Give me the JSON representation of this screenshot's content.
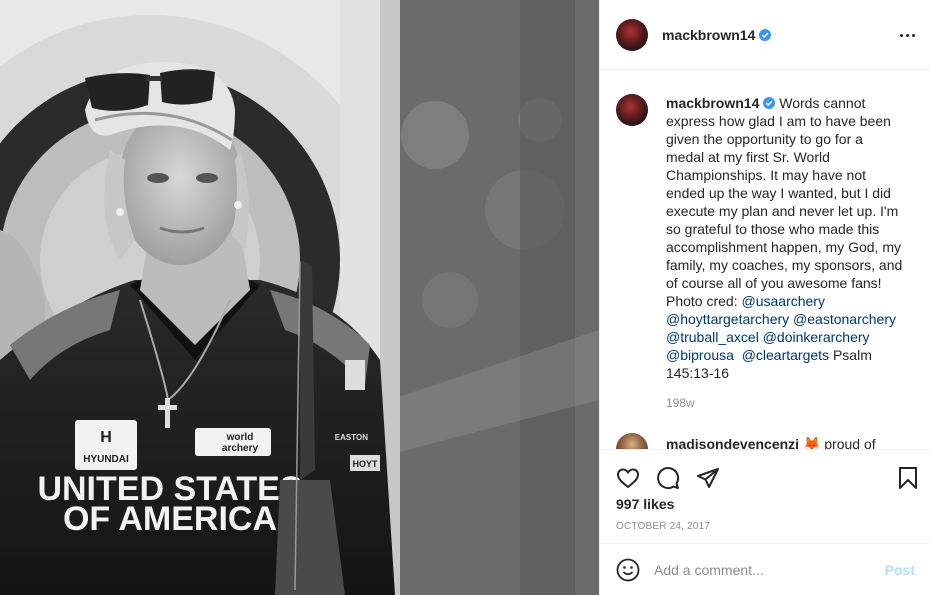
{
  "header": {
    "username": "mackbrown14",
    "verified": true
  },
  "caption": {
    "username": "mackbrown14",
    "text_main": "Words cannot express how glad I am to have been given the opportunity to go for a medal at my first Sr. World Championships. It may have not ended up the way I wanted, but I did execute my plan and never let up. I'm so grateful to those who made this accomplishment happen, my God, my family, my coaches, my sponsors, and of course all of you awesome fans! Photo cred:",
    "tags": [
      "@usaarchery",
      "@hoyttargetarchery",
      "@eastonarchery",
      "@truball_axcel",
      "@doinkerarchery",
      "@biprousa",
      "@cleartargets"
    ],
    "text_end": "Psalm 145:13-16",
    "age": "198w"
  },
  "next_comment": {
    "username": "madisondevencenzi",
    "text": "proud of"
  },
  "actions": {
    "likes": "997 likes",
    "date": "OCTOBER 24, 2017"
  },
  "add_comment": {
    "placeholder": "Add a comment...",
    "post_label": "Post"
  },
  "photo": {
    "jersey_line1": "UNITED STATES",
    "jersey_line2": "OF AMERICA",
    "sponsor1": "HYUNDAI",
    "sponsor2_line1": "world",
    "sponsor2_line2": "archery",
    "sleeve1": "EASTON",
    "sleeve2": "HOYT"
  },
  "colors": {
    "link": "#00376b",
    "verified": "#3897f0",
    "muted": "#8e8e8e",
    "post_disabled": "#b2dffc"
  }
}
